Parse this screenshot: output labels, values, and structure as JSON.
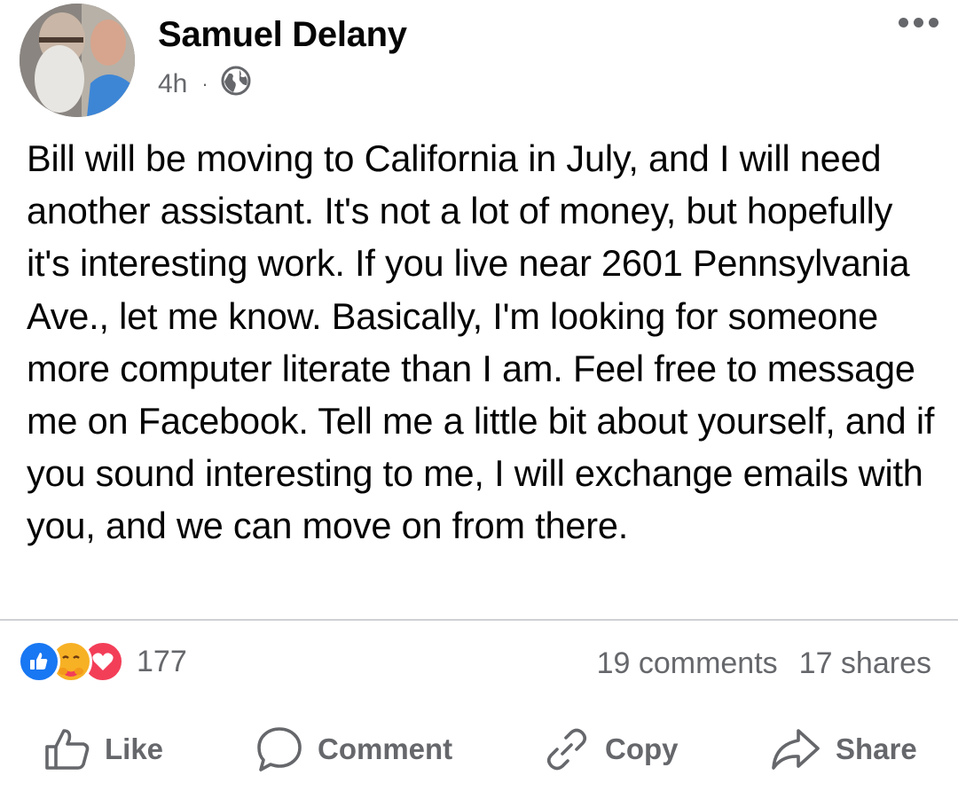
{
  "post": {
    "author": "Samuel Delany",
    "time": "4h",
    "separator": "·",
    "privacy_icon": "globe-icon",
    "more_icon": "more-options-icon",
    "text": "Bill will be moving to California in July, and I will need another assistant. It's not a lot of money, but hopefully it's interesting work. If you live near 2601 Pennsylvania Ave., let me know. Basically, I'm looking for someone more computer literate than I am. Feel free to message me on Facebook. Tell me a little bit about yourself, and if you sound interesting to me, I will exchange emails with you, and we can move on from there."
  },
  "reactions": {
    "icons": [
      "like-reaction-icon",
      "care-reaction-icon",
      "love-reaction-icon"
    ],
    "count": "177",
    "comments": "19 comments",
    "shares": "17 shares"
  },
  "actions": {
    "like": "Like",
    "comment": "Comment",
    "copy": "Copy",
    "share": "Share"
  },
  "colors": {
    "text": "#050505",
    "secondary": "#65676b",
    "divider": "#ced0d4",
    "like_blue": "#1877f2",
    "care_yellow": "#f7b125",
    "love_red": "#f33e58"
  }
}
